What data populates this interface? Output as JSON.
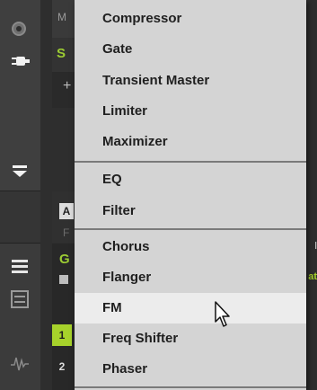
{
  "menu": {
    "groups": [
      {
        "items": [
          "Compressor",
          "Gate",
          "Transient Master",
          "Limiter",
          "Maximizer"
        ]
      },
      {
        "items": [
          "EQ",
          "Filter"
        ]
      },
      {
        "items": [
          "Chorus",
          "Flanger",
          "FM",
          "Freq Shifter",
          "Phaser"
        ]
      }
    ],
    "highlighted_item": "FM"
  },
  "background": {
    "top_letter": "M",
    "slot_letter": "S",
    "plus_sign": "+",
    "slot_a_letter": "A",
    "slot_f_letter": "F",
    "group_letter": "G",
    "pad_1": "1",
    "pad_2": "2",
    "edge_text_1": "at",
    "edge_text_2": "l"
  },
  "colors": {
    "menu_bg": "#d4d4d4",
    "highlight_bg": "#ececec",
    "accent_green": "#a7d22b"
  },
  "icons": [
    "knob-icon",
    "plugin-icon",
    "dropdown-icon",
    "list-icon",
    "mixer-icon",
    "waveform-icon",
    "speaker-icon",
    "mouse-cursor-icon"
  ]
}
